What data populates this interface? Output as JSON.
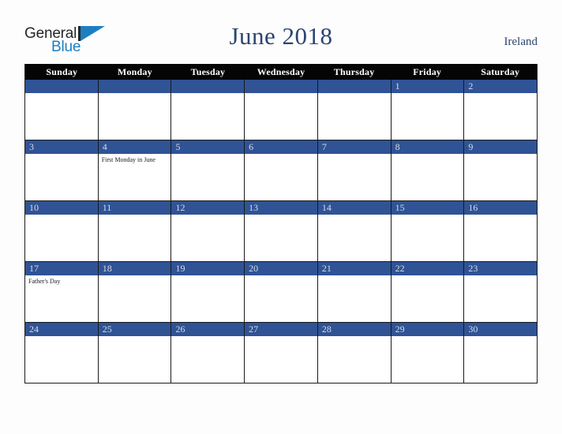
{
  "brand": {
    "name_part1": "General",
    "name_part2": "Blue",
    "mark": "triangle-flag"
  },
  "header": {
    "title": "June 2018",
    "country": "Ireland"
  },
  "colors": {
    "header_bar": "#050505",
    "day_bar_blue": "#2f5395",
    "title_navy": "#2b4570",
    "brand_blue": "#1c7fc4",
    "page_background": "#fdfdfd",
    "cell_background": "#ffffff",
    "grid_line": "#1a1a1a"
  },
  "calendar": {
    "weekday_headers": [
      "Sunday",
      "Monday",
      "Tuesday",
      "Wednesday",
      "Thursday",
      "Friday",
      "Saturday"
    ],
    "weeks": [
      [
        {
          "day": "",
          "events": []
        },
        {
          "day": "",
          "events": []
        },
        {
          "day": "",
          "events": []
        },
        {
          "day": "",
          "events": []
        },
        {
          "day": "",
          "events": []
        },
        {
          "day": "1",
          "events": []
        },
        {
          "day": "2",
          "events": []
        }
      ],
      [
        {
          "day": "3",
          "events": []
        },
        {
          "day": "4",
          "events": [
            "First Monday in June"
          ]
        },
        {
          "day": "5",
          "events": []
        },
        {
          "day": "6",
          "events": []
        },
        {
          "day": "7",
          "events": []
        },
        {
          "day": "8",
          "events": []
        },
        {
          "day": "9",
          "events": []
        }
      ],
      [
        {
          "day": "10",
          "events": []
        },
        {
          "day": "11",
          "events": []
        },
        {
          "day": "12",
          "events": []
        },
        {
          "day": "13",
          "events": []
        },
        {
          "day": "14",
          "events": []
        },
        {
          "day": "15",
          "events": []
        },
        {
          "day": "16",
          "events": []
        }
      ],
      [
        {
          "day": "17",
          "events": [
            "Father's Day"
          ]
        },
        {
          "day": "18",
          "events": []
        },
        {
          "day": "19",
          "events": []
        },
        {
          "day": "20",
          "events": []
        },
        {
          "day": "21",
          "events": []
        },
        {
          "day": "22",
          "events": []
        },
        {
          "day": "23",
          "events": []
        }
      ],
      [
        {
          "day": "24",
          "events": []
        },
        {
          "day": "25",
          "events": []
        },
        {
          "day": "26",
          "events": []
        },
        {
          "day": "27",
          "events": []
        },
        {
          "day": "28",
          "events": []
        },
        {
          "day": "29",
          "events": []
        },
        {
          "day": "30",
          "events": []
        }
      ]
    ]
  }
}
